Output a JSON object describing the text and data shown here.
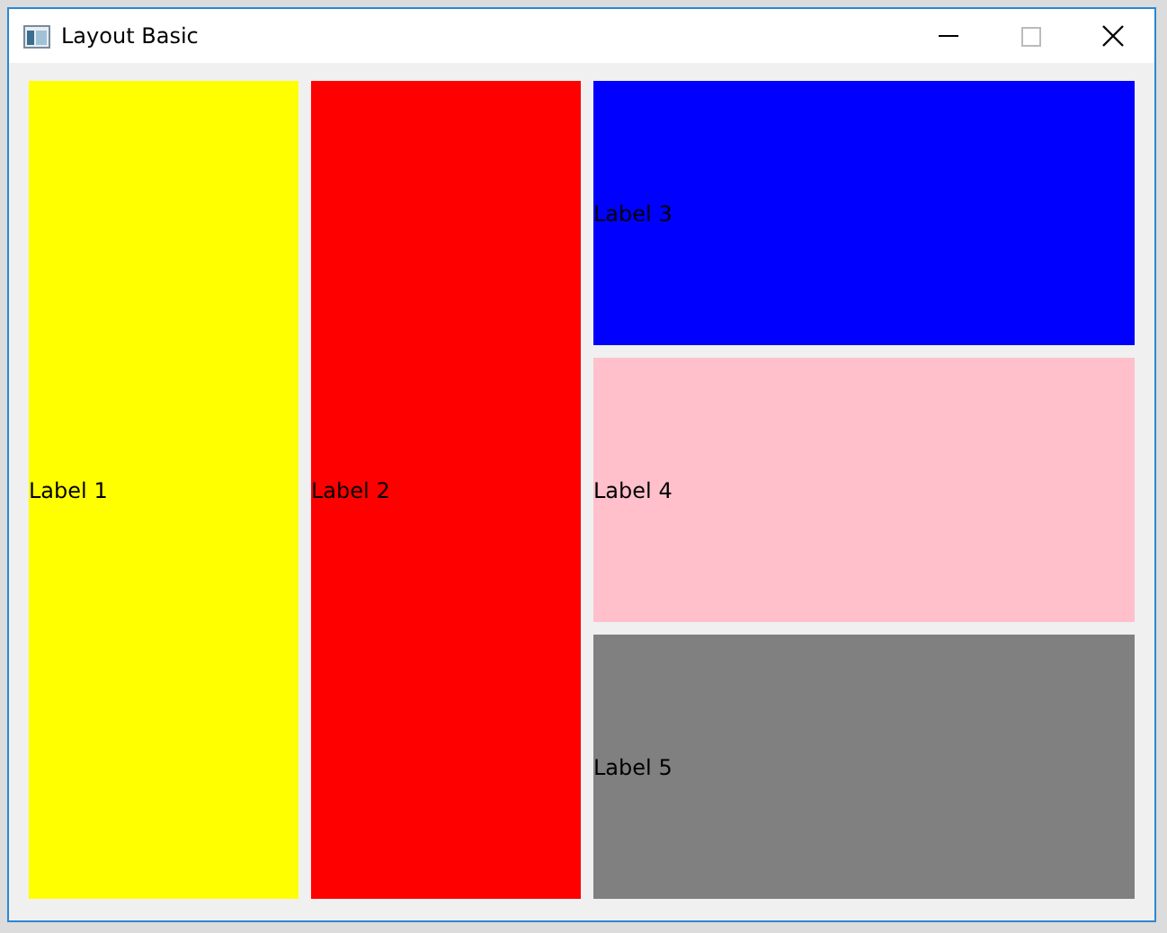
{
  "window": {
    "title": "Layout Basic"
  },
  "columns": [
    [
      {
        "label": "Label 1",
        "color": "#ffff00"
      }
    ],
    [
      {
        "label": "Label 2",
        "color": "#ff0000"
      }
    ],
    [
      {
        "label": "Label 3",
        "color": "#0000ff"
      },
      {
        "label": "Label 4",
        "color": "#ffc0cb"
      },
      {
        "label": "Label 5",
        "color": "#808080"
      }
    ]
  ]
}
